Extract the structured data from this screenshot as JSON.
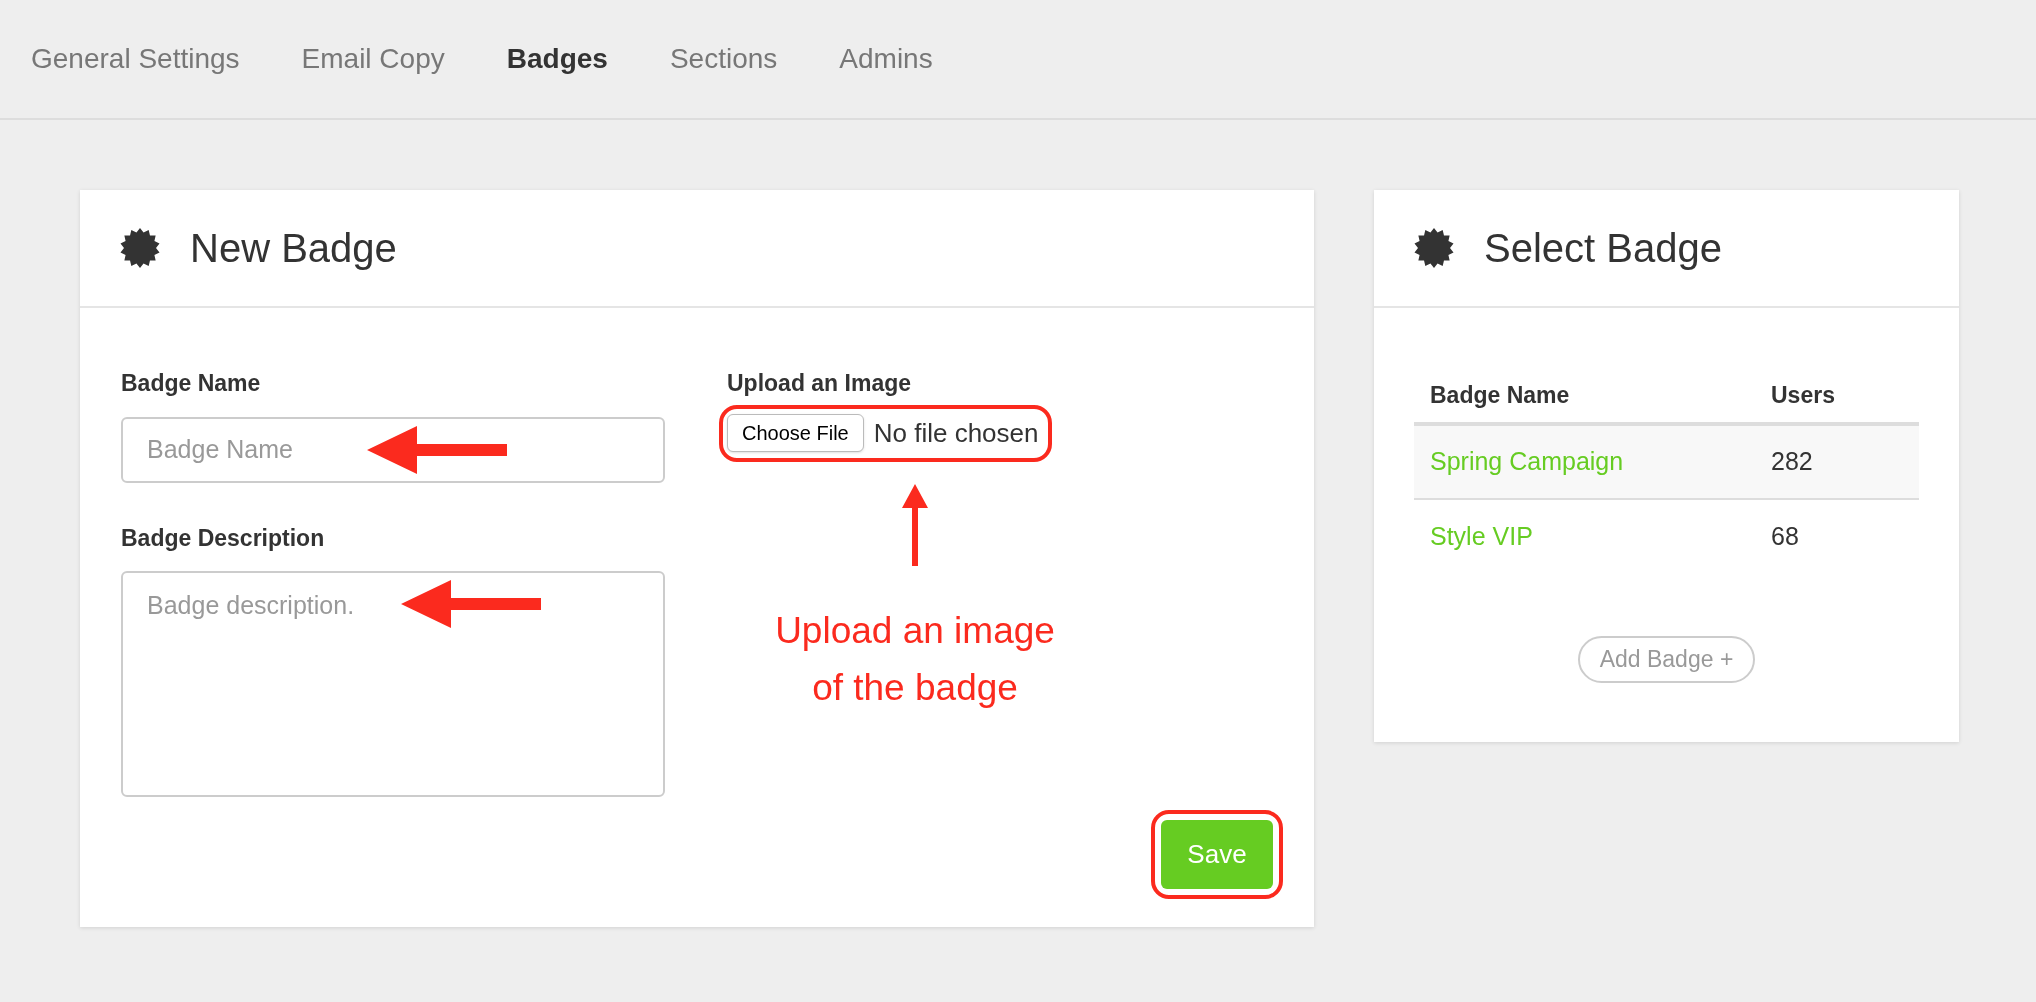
{
  "tabs": [
    {
      "label": "General Settings",
      "selected": false
    },
    {
      "label": "Email Copy",
      "selected": false
    },
    {
      "label": "Badges",
      "selected": true
    },
    {
      "label": "Sections",
      "selected": false
    },
    {
      "label": "Admins",
      "selected": false
    }
  ],
  "new_badge": {
    "title": "New Badge",
    "name_field": {
      "label": "Badge Name",
      "placeholder": "Badge Name"
    },
    "description_field": {
      "label": "Badge Description",
      "placeholder": "Badge description."
    },
    "upload": {
      "label": "Upload an Image",
      "button": "Choose File",
      "status": "No file chosen"
    },
    "save_button": "Save"
  },
  "annotation": {
    "note": "Upload an image\nof the badge"
  },
  "select_badge": {
    "title": "Select Badge",
    "columns": [
      "Badge Name",
      "Users"
    ],
    "rows": [
      {
        "name": "Spring Campaign",
        "users": "282"
      },
      {
        "name": "Style VIP",
        "users": "68"
      }
    ],
    "add_button": "Add Badge +"
  }
}
